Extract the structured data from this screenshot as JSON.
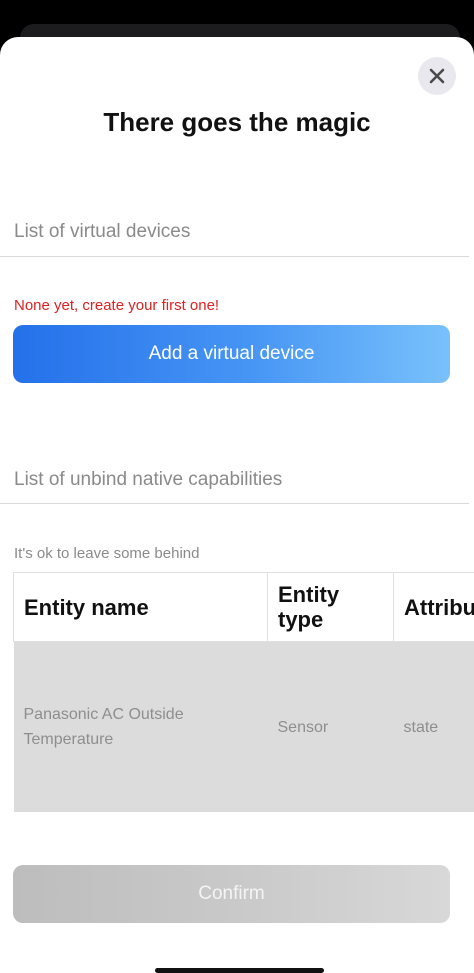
{
  "modal": {
    "title": "There goes the magic",
    "close_icon": "close-icon"
  },
  "virtual_devices": {
    "label": "List of virtual devices",
    "empty_message": "None yet, create your first one!",
    "add_button_label": "Add a virtual device"
  },
  "native_capabilities": {
    "label": "List of unbind native capabilities",
    "hint": "It's ok to leave some behind",
    "columns": [
      "Entity name",
      "Entity type",
      "Attribu"
    ],
    "rows": [
      {
        "entity_name": "Panasonic AC Outside Temperature",
        "entity_type": "Sensor",
        "attribute": "state"
      }
    ]
  },
  "footer": {
    "confirm_label": "Confirm"
  },
  "colors": {
    "accent_start": "#2470ea",
    "accent_end": "#79c1fb",
    "error": "#e02020",
    "disabled_button": "#c8c8c8",
    "row_background": "#dcdcdc"
  }
}
